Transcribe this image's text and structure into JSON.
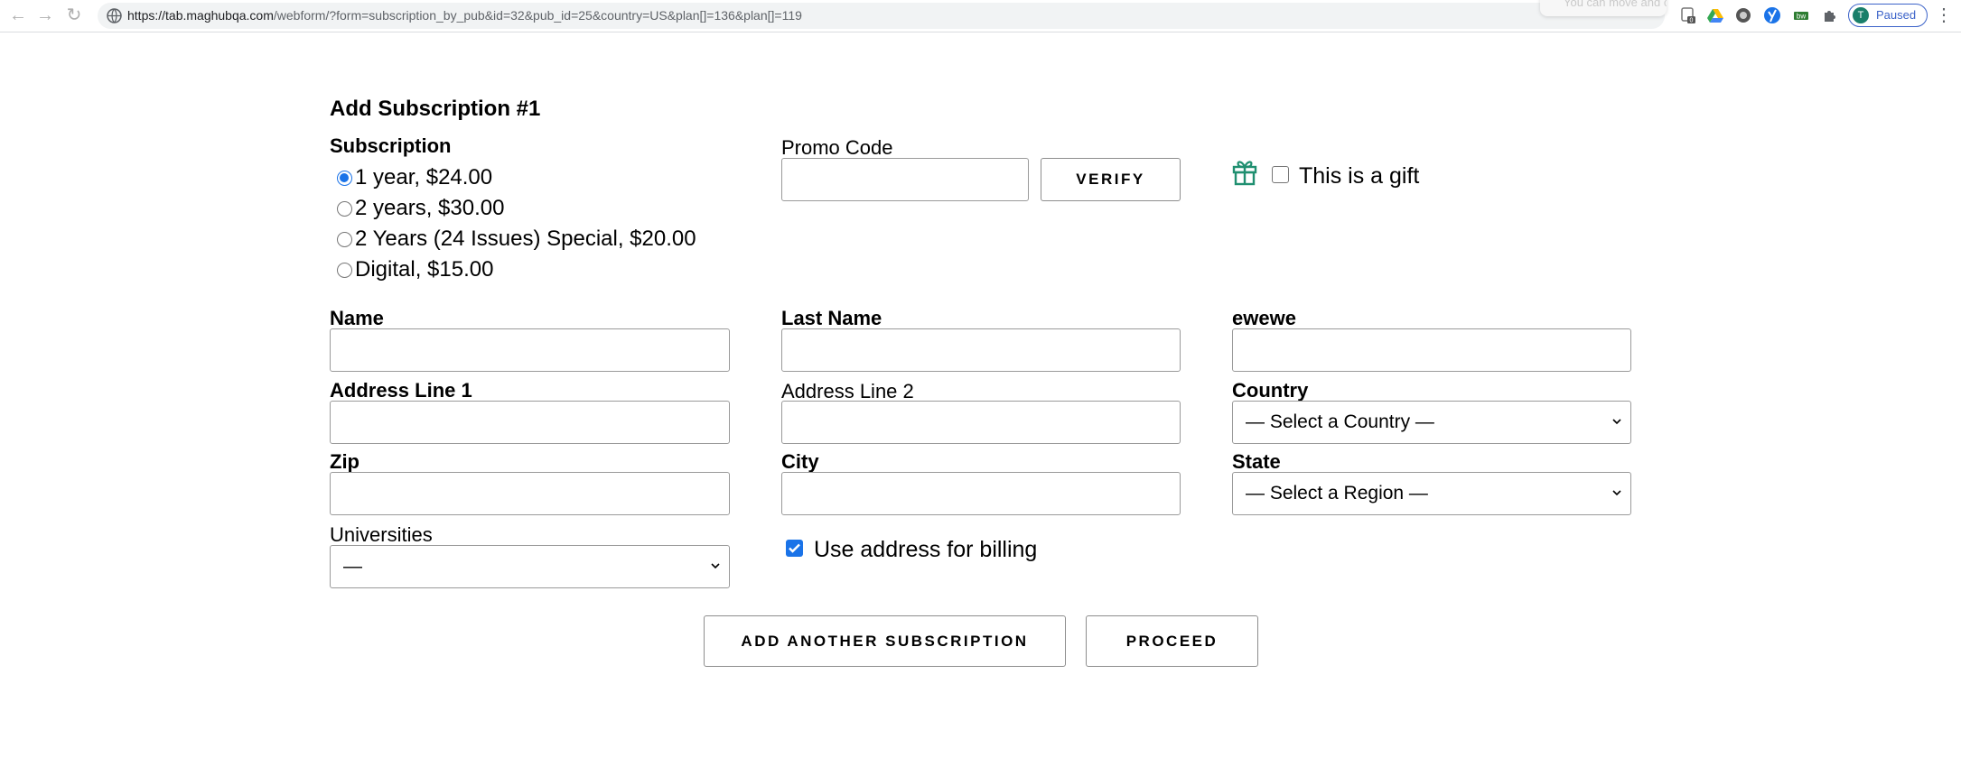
{
  "browser": {
    "url_host": "https://tab.maghubqa.com",
    "url_path": "/webform/?form=subscription_by_pub&id=32&pub_id=25&country=US&plan[]=136&plan[]=119",
    "profile_initial": "T",
    "profile_status": "Paused",
    "tooltip_fragment": "You can move and change the size of your selection"
  },
  "form": {
    "title": "Add Subscription #1",
    "subscription_label": "Subscription",
    "plans": [
      {
        "label": "1 year, $24.00",
        "checked": true
      },
      {
        "label": "2 years, $30.00",
        "checked": false
      },
      {
        "label": "2 Years (24 Issues) Special, $20.00",
        "checked": false
      },
      {
        "label": "Digital, $15.00",
        "checked": false
      }
    ],
    "promo_label": "Promo Code",
    "promo_value": "",
    "verify_label": "VERIFY",
    "gift_label": "This is a gift",
    "gift_checked": false,
    "fields": {
      "name_label": "Name",
      "last_name_label": "Last Name",
      "ewewe_label": "ewewe",
      "address1_label": "Address Line 1",
      "address2_label": "Address Line 2",
      "country_label": "Country",
      "country_value": "— Select a Country —",
      "zip_label": "Zip",
      "city_label": "City",
      "state_label": "State",
      "state_value": "— Select a Region —",
      "universities_label": "Universities",
      "universities_value": "—"
    },
    "billing_label": "Use address for billing",
    "billing_checked": true,
    "add_another_label": "ADD ANOTHER SUBSCRIPTION",
    "proceed_label": "PROCEED"
  },
  "colors": {
    "accent": "#1a73e8",
    "gift_icon": "#1f8f70",
    "profile_ring": "#3c63c9"
  }
}
